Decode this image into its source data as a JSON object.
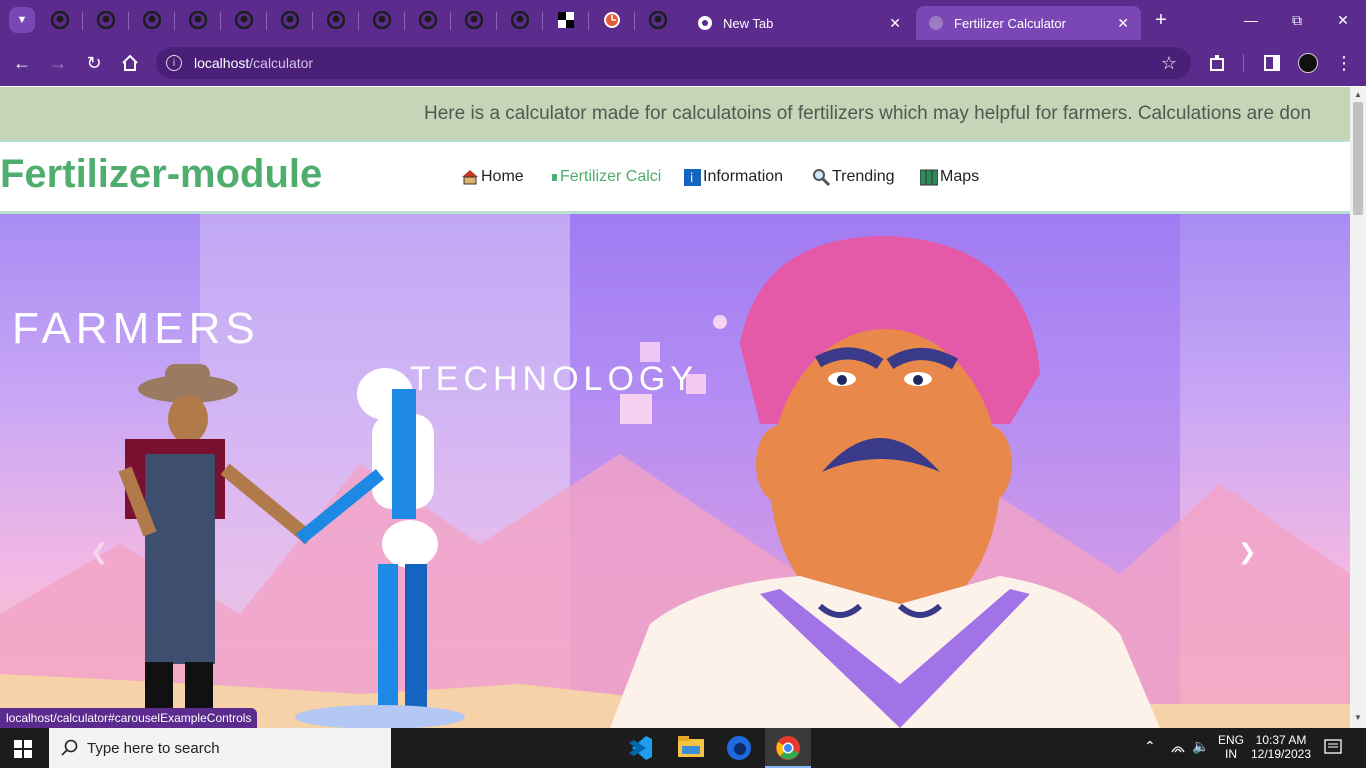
{
  "browser": {
    "tabs": [
      {
        "title": "New Tab",
        "active": false
      },
      {
        "title": "Fertilizer Calculator",
        "active": true
      }
    ],
    "pinned_icons": [
      "github-icon",
      "github-icon",
      "github-icon",
      "github-icon",
      "github-icon",
      "github-icon",
      "github-icon",
      "github-icon",
      "github-icon",
      "github-icon",
      "github-icon",
      "checker-icon",
      "clock-icon",
      "github-icon"
    ],
    "url_host": "localhost",
    "url_path": "/calculator",
    "status_url": "localhost/calculator#carouselExampleControls"
  },
  "page": {
    "marquee_text": "Here is a calculator made for calculatoins of fertilizers which may helpful for farmers. Calculations are don",
    "brand": "Fertilizer-module",
    "nav": [
      {
        "label": "Home",
        "icon": "house-icon"
      },
      {
        "label": "Fertilizer Calci",
        "icon": "fertilizer-icon",
        "active": true
      },
      {
        "label": "Information",
        "icon": "info-icon"
      },
      {
        "label": "Trending",
        "icon": "magnifier-icon"
      },
      {
        "label": "Maps",
        "icon": "map-icon"
      }
    ],
    "hero": {
      "word1": "Farmers",
      "word2": "Technology"
    }
  },
  "taskbar": {
    "search_placeholder": "Type here to search",
    "lang_top": "ENG",
    "lang_bottom": "IN",
    "time": "10:37 AM",
    "date": "12/19/2023"
  },
  "colors": {
    "brand": "#4fae6e",
    "chrome": "#5b2b8e"
  }
}
